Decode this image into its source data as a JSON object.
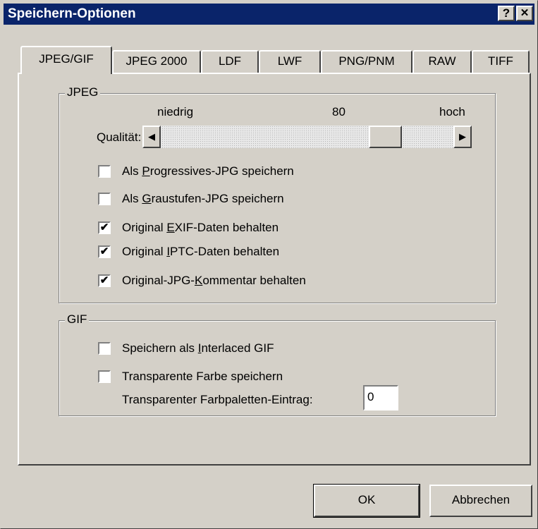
{
  "window": {
    "title": "Speichern-Optionen",
    "help_label": "?",
    "close_label": "✕"
  },
  "tabs": [
    "JPEG/GIF",
    "JPEG 2000",
    "LDF",
    "LWF",
    "PNG/PNM",
    "RAW",
    "TIFF"
  ],
  "active_tab": 0,
  "jpeg": {
    "legend": "JPEG",
    "low_label": "niedrig",
    "value_label": "80",
    "high_label": "hoch",
    "quality_label": "Qualität:",
    "quality_value": 80,
    "options": [
      {
        "pre": "Als ",
        "key": "P",
        "post": "rogressives-JPG speichern",
        "checked": false,
        "mark": ""
      },
      {
        "pre": "Als ",
        "key": "G",
        "post": "raustufen-JPG speichern",
        "checked": false,
        "mark": ""
      },
      {
        "pre": "Original ",
        "key": "E",
        "post": "XIF-Daten behalten",
        "checked": true,
        "mark": "✔"
      },
      {
        "pre": "Original ",
        "key": "I",
        "post": "PTC-Daten behalten",
        "checked": true,
        "mark": "✔"
      },
      {
        "pre": "Original-JPG-",
        "key": "K",
        "post": "ommentar behalten",
        "checked": true,
        "mark": "✔"
      }
    ]
  },
  "gif": {
    "legend": "GIF",
    "options": [
      {
        "pre": "Speichern als ",
        "key": "I",
        "post": "nterlaced GIF",
        "checked": false,
        "mark": ""
      },
      {
        "pre": "Transparente Farbe speichern",
        "key": "",
        "post": "",
        "checked": false,
        "mark": ""
      }
    ],
    "palette_label": "Transparenter Farbpaletten-Eintrag:",
    "palette_value": "0"
  },
  "buttons": {
    "ok": "OK",
    "cancel": "Abbrechen"
  }
}
